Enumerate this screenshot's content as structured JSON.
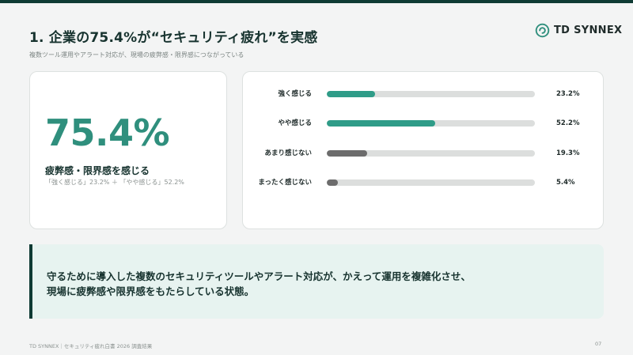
{
  "header": {
    "title": "1. 企業の75.4%が“セキュリティ疲れ”を実感",
    "subtitle": "複数ツール運用やアラート対応が、現場の疲弊感・限界感につながっている"
  },
  "brand": {
    "name": "TD SYNNEX",
    "icon": "td-synnex-logo-icon",
    "accent": "#2f8f7d",
    "dark": "#0f3b34"
  },
  "summary": {
    "percent": "75.4%",
    "label": "疲弊感・限界感を感じる",
    "note": "「強く感じる」23.2% ＋ 「やや感じる」52.2%"
  },
  "bars": [
    {
      "label": "強く感じる",
      "value": 23.2,
      "display": "23.2%",
      "color": "#2f9c88"
    },
    {
      "label": "やや感じる",
      "value": 52.2,
      "display": "52.2%",
      "color": "#2f9c88"
    },
    {
      "label": "あまり感じない",
      "value": 19.3,
      "display": "19.3%",
      "color": "#6c6c6c"
    },
    {
      "label": "まったく感じない",
      "value": 5.4,
      "display": "5.4%",
      "color": "#6c6c6c"
    }
  ],
  "callout": {
    "line1": "守るために導入した複数のセキュリティツールやアラート対応が、かえって運用を複雑化させ、",
    "line2": "現場に疲弊感や限界感をもたらしている状態。"
  },
  "footer": {
    "left": "TD SYNNEX｜セキュリティ疲れ白書 2026 調査結果",
    "page": "07"
  }
}
